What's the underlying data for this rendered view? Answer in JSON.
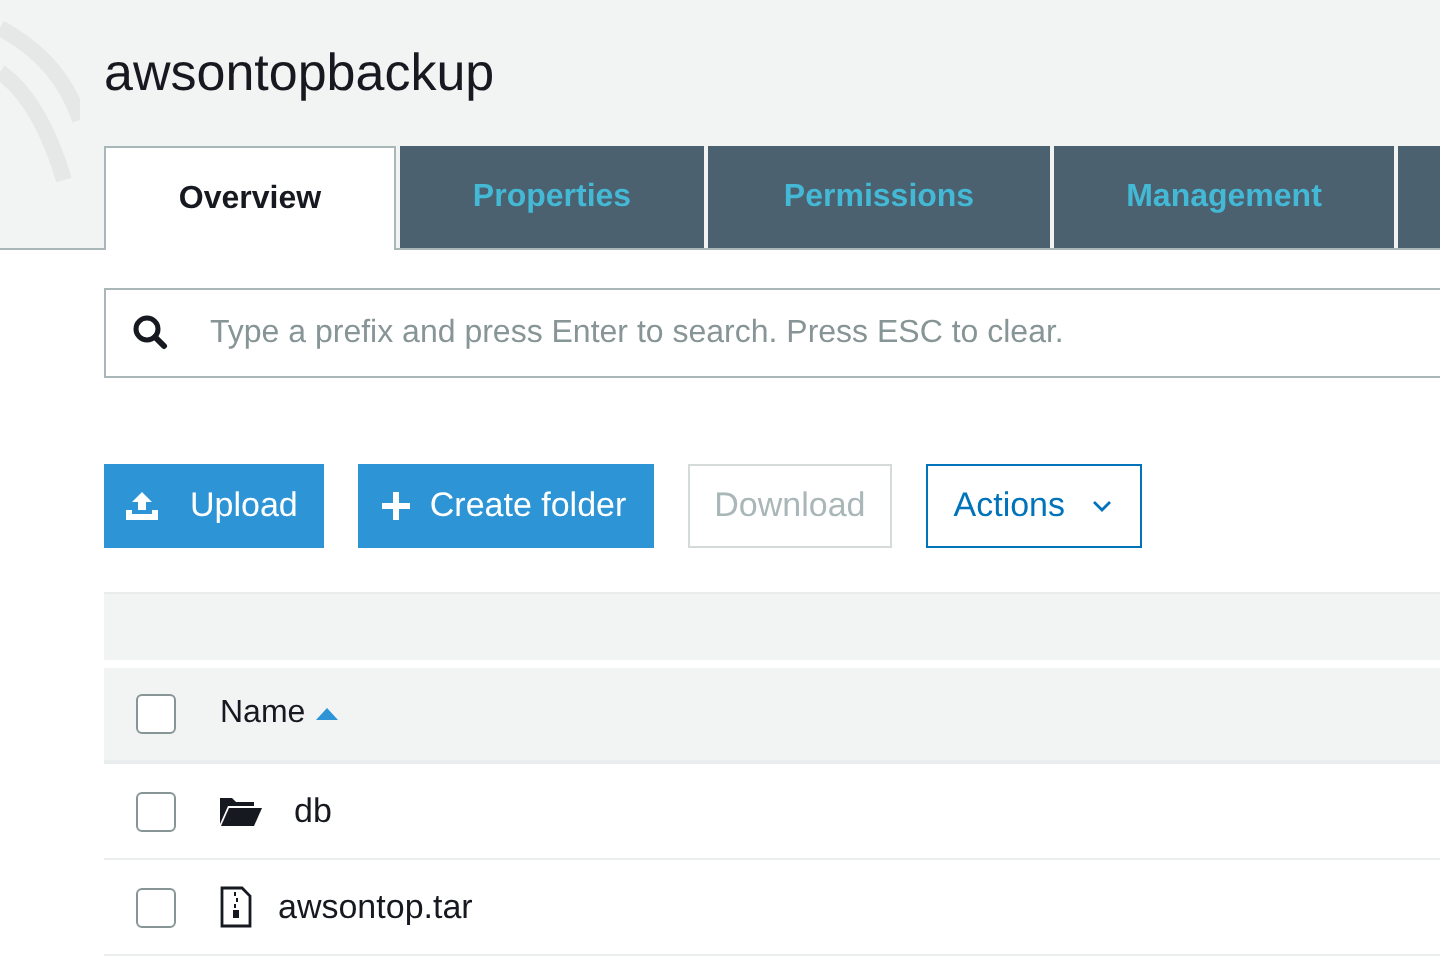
{
  "title": "awsontopbackup",
  "tabs": [
    {
      "label": "Overview",
      "selected": true
    },
    {
      "label": "Properties",
      "selected": false
    },
    {
      "label": "Permissions",
      "selected": false
    },
    {
      "label": "Management",
      "selected": false
    }
  ],
  "search": {
    "placeholder": "Type a prefix and press Enter to search. Press ESC to clear."
  },
  "buttons": [
    {
      "kind": "upload",
      "label": "Upload",
      "disabled": false
    },
    {
      "kind": "create",
      "label": "Create folder",
      "disabled": false
    },
    {
      "kind": "plain",
      "label": "Download",
      "disabled": true
    },
    {
      "kind": "menu",
      "label": "Actions",
      "disabled": false
    }
  ],
  "table": {
    "columns": [
      {
        "label": "Name",
        "sorted_ascending": true
      }
    ],
    "select_all": {
      "checked": false
    },
    "rows": [
      {
        "kind": "folder",
        "name": "db",
        "checked": false
      },
      {
        "kind": "file",
        "name": "awsontop.tar",
        "checked": false
      }
    ]
  }
}
